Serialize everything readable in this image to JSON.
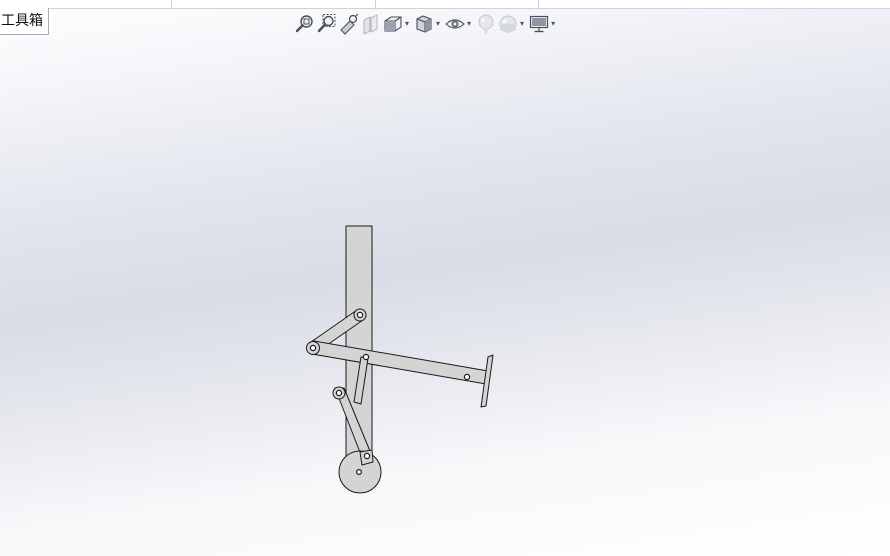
{
  "toolbox": {
    "label": "工具箱"
  },
  "hud_toolbar": {
    "buttons": [
      {
        "icon": "zoom-to-fit-icon",
        "has_dropdown": false,
        "enabled": true
      },
      {
        "icon": "zoom-to-area-icon",
        "has_dropdown": false,
        "enabled": true
      },
      {
        "icon": "previous-view-icon",
        "has_dropdown": false,
        "enabled": true
      },
      {
        "icon": "section-view-icon",
        "has_dropdown": false,
        "enabled": false
      },
      {
        "icon": "view-orientation-icon",
        "has_dropdown": true,
        "enabled": true
      },
      {
        "icon": "display-style-icon",
        "has_dropdown": true,
        "enabled": true
      },
      {
        "icon": "hide-show-items-icon",
        "has_dropdown": true,
        "enabled": true
      },
      {
        "icon": "edit-appearance-icon",
        "has_dropdown": false,
        "enabled": false
      },
      {
        "icon": "apply-scene-icon",
        "has_dropdown": true,
        "enabled": false
      },
      {
        "icon": "view-settings-icon",
        "has_dropdown": true,
        "enabled": true
      }
    ],
    "dropdown_glyph": "▾"
  },
  "colors": {
    "part_fill": "#d4d4d4",
    "part_stroke": "#1a1a1a",
    "background_top": "#ffffff",
    "background_mid": "#d9dce6"
  }
}
